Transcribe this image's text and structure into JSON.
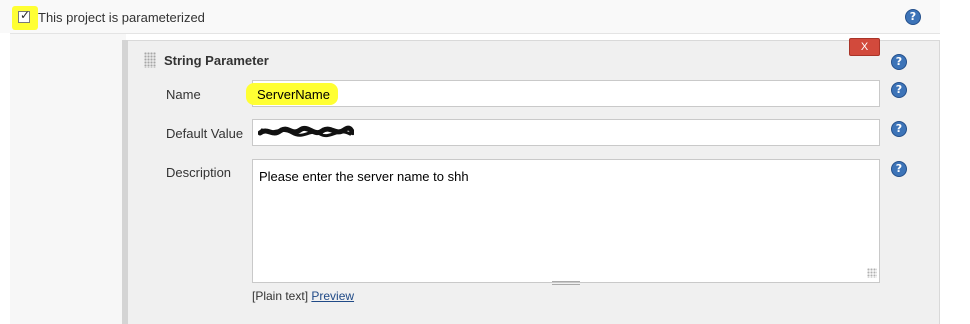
{
  "project": {
    "parameterized_label": "This project is parameterized",
    "parameterized_checked": true
  },
  "parameter": {
    "type_title": "String Parameter",
    "delete_label": "X",
    "fields": {
      "name": {
        "label": "Name",
        "value": "ServerName"
      },
      "default_value": {
        "label": "Default Value",
        "value": ""
      },
      "description": {
        "label": "Description",
        "value": "Please enter the server name to shh"
      }
    },
    "markup": {
      "plain_text_label": "[Plain text]",
      "preview_label": "Preview"
    }
  },
  "colors": {
    "highlight": "#ffff33",
    "help_icon": "#3d74b8",
    "delete_button": "#d24a3c",
    "link": "#204a87"
  },
  "icons": {
    "help": "help-icon",
    "drag": "drag-handle-icon",
    "resize": "resize-grip-icon"
  }
}
